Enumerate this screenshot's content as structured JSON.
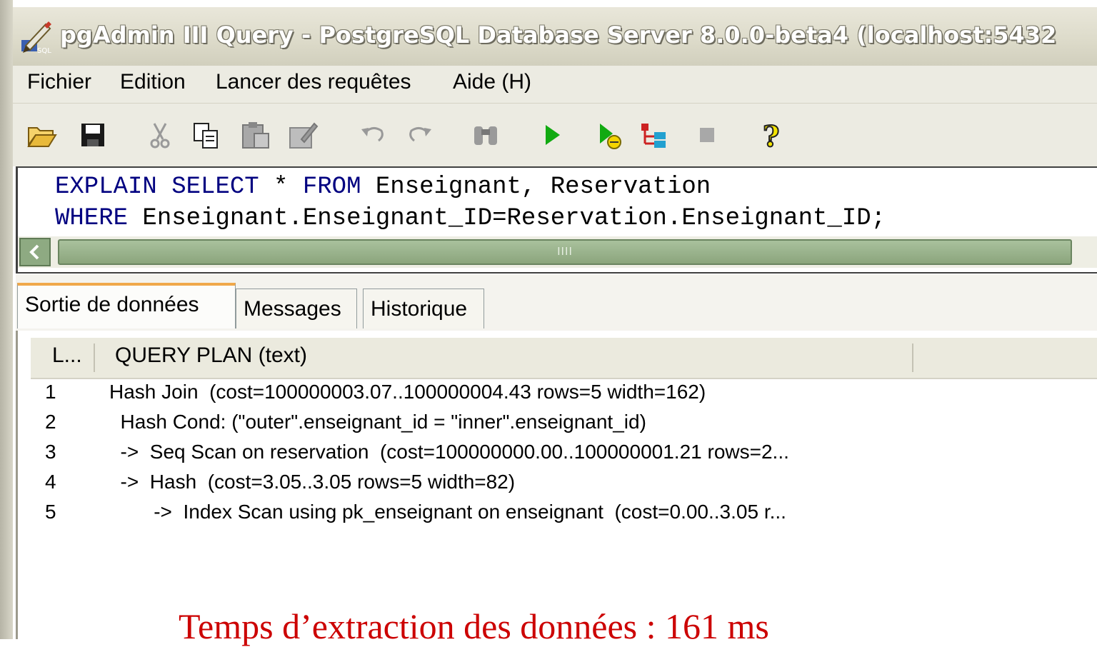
{
  "window": {
    "title": "pgAdmin III Query - PostgreSQL Database Server 8.0.0-beta4 (localhost:5432"
  },
  "menu": {
    "items": [
      "Fichier",
      "Edition",
      "Lancer des requêtes",
      "Aide (H)"
    ]
  },
  "toolbar": {
    "icons": [
      "open-folder-icon",
      "save-icon",
      "cut-icon",
      "copy-icon",
      "paste-icon",
      "edit-icon",
      "undo-icon",
      "redo-icon",
      "find-icon",
      "execute-icon",
      "execute-to-file-icon",
      "explain-icon",
      "stop-icon",
      "help-icon"
    ]
  },
  "editor": {
    "line1": {
      "kw1": "EXPLAIN",
      "kw2": "SELECT",
      "star": " * ",
      "kw3": "FROM",
      "rest": " Enseignant, Reservation"
    },
    "line2": {
      "kw1": "WHERE",
      "rest": " Enseignant.Enseignant_ID=Reservation.Enseignant_ID;"
    },
    "scroll_grip": "IIII"
  },
  "tabs": [
    "Sortie de données",
    "Messages",
    "Historique"
  ],
  "grid": {
    "columns": [
      "L...",
      "QUERY PLAN (text)"
    ],
    "rows": [
      {
        "num": "1",
        "text": "Hash Join  (cost=100000003.07..100000004.43 rows=5 width=162)"
      },
      {
        "num": "2",
        "text": "  Hash Cond: (\"outer\".enseignant_id = \"inner\".enseignant_id)"
      },
      {
        "num": "3",
        "text": "  ->  Seq Scan on reservation  (cost=100000000.00..100000001.21 rows=2..."
      },
      {
        "num": "4",
        "text": "  ->  Hash  (cost=3.05..3.05 rows=5 width=82)"
      },
      {
        "num": "5",
        "text": "        ->  Index Scan using pk_enseignant on enseignant  (cost=0.00..3.05 r..."
      }
    ]
  },
  "caption": "Temps d’extraction des données : 161 ms",
  "colors": {
    "caption": "#cc0000",
    "keyword": "#000080",
    "active_tab_accent": "#f0a84a"
  }
}
